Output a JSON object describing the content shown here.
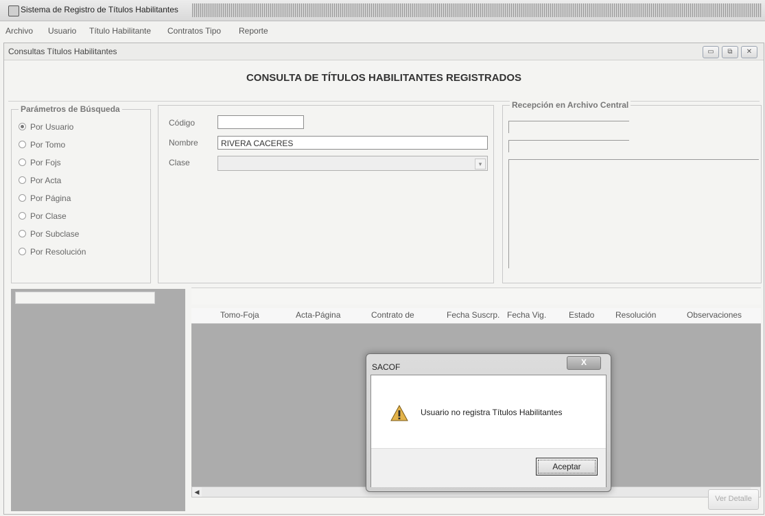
{
  "window": {
    "title": "Sistema de Registro de Títulos Habilitantes"
  },
  "menu": [
    "Archivo",
    "Usuario",
    "Título Habilitante",
    "Contratos Tipo",
    "Reporte"
  ],
  "child_window": {
    "title": "Consultas Títulos Habilitantes",
    "buttons": [
      "▭",
      "⧉",
      "✕"
    ]
  },
  "heading": "CONSULTA DE TÍTULOS HABILITANTES REGISTRADOS",
  "search_params": {
    "legend": "Parámetros de Búsqueda",
    "options": [
      "Por Usuario",
      "Por Tomo",
      "Por Fojs",
      "Por Acta",
      "Por Página",
      "Por Clase",
      "Por Subclase",
      "Por Resolución"
    ],
    "selected": "Por Usuario"
  },
  "fields": {
    "codigo_label": "Código",
    "codigo_value": "",
    "nombre_label": "Nombre",
    "nombre_value": "RIVERA CACERES",
    "clase_label": "Clase",
    "clase_value": ""
  },
  "recepcion": {
    "legend": "Recepción en Archivo Central"
  },
  "results_grid": {
    "columns": [
      "Tomo-Foja",
      "Acta-Página",
      "Contrato de",
      "Fecha Suscrp.",
      "Fecha Vig.",
      "Estado",
      "Resolución",
      "Observaciones"
    ]
  },
  "dialog": {
    "title": "SACOF",
    "close": "X",
    "message": "Usuario no registra Títulos Habilitantes",
    "ok": "Aceptar"
  },
  "detail_button": "Ver Detalle",
  "colors": {
    "grid_background": "#acacac",
    "window_background": "#f4f4f2"
  }
}
